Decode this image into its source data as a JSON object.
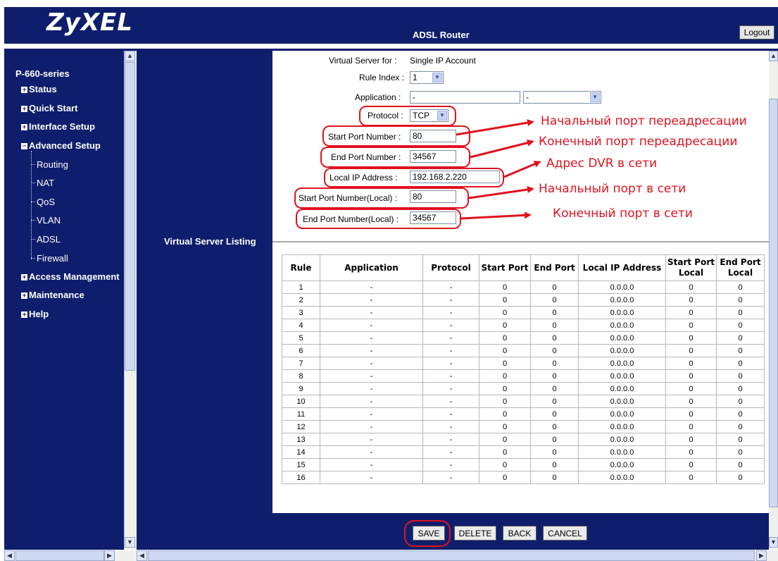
{
  "header": {
    "logo": "ZyXEL",
    "title": "ADSL Router",
    "logout_label": "Logout"
  },
  "sidebar": {
    "series": "P-660-series",
    "items": [
      {
        "label": "Status"
      },
      {
        "label": "Quick Start"
      },
      {
        "label": "Interface Setup"
      },
      {
        "label": "Advanced Setup"
      },
      {
        "label": "Access Management"
      },
      {
        "label": "Maintenance"
      },
      {
        "label": "Help"
      }
    ],
    "subitems": [
      "Routing",
      "NAT",
      "QoS",
      "VLAN",
      "ADSL",
      "Firewall"
    ]
  },
  "form": {
    "virtual_server_label": "Virtual Server for :",
    "virtual_server_value": "Single IP Account",
    "rule_index_label": "Rule Index :",
    "rule_index_value": "1",
    "application_label": "Application :",
    "application_value": "-",
    "application_select": "-",
    "protocol_label": "Protocol :",
    "protocol_value": "TCP",
    "start_port_label": "Start Port Number :",
    "start_port_value": "80",
    "end_port_label": "End Port Number :",
    "end_port_value": "34567",
    "local_ip_label": "Local IP Address :",
    "local_ip_value": "192.168.2.220",
    "start_port_local_label": "Start Port Number(Local) :",
    "start_port_local_value": "80",
    "end_port_local_label": "End Port Number(Local) :",
    "end_port_local_value": "34567"
  },
  "annotations": {
    "a1": "Начальный порт переадресации",
    "a2": "Конечный порт переадресации",
    "a3": "Адрес DVR в сети",
    "a4": "Начальный порт в сети",
    "a5": "Конечный порт в сети"
  },
  "listing": {
    "label": "Virtual Server Listing",
    "headers": [
      "Rule",
      "Application",
      "Protocol",
      "Start Port",
      "End Port",
      "Local IP Address",
      "Start Port Local",
      "End Port Local"
    ],
    "rows": [
      [
        "1",
        "-",
        "-",
        "0",
        "0",
        "0.0.0.0",
        "0",
        "0"
      ],
      [
        "2",
        "-",
        "-",
        "0",
        "0",
        "0.0.0.0",
        "0",
        "0"
      ],
      [
        "3",
        "-",
        "-",
        "0",
        "0",
        "0.0.0.0",
        "0",
        "0"
      ],
      [
        "4",
        "-",
        "-",
        "0",
        "0",
        "0.0.0.0",
        "0",
        "0"
      ],
      [
        "5",
        "-",
        "-",
        "0",
        "0",
        "0.0.0.0",
        "0",
        "0"
      ],
      [
        "6",
        "-",
        "-",
        "0",
        "0",
        "0.0.0.0",
        "0",
        "0"
      ],
      [
        "7",
        "-",
        "-",
        "0",
        "0",
        "0.0.0.0",
        "0",
        "0"
      ],
      [
        "8",
        "-",
        "-",
        "0",
        "0",
        "0.0.0.0",
        "0",
        "0"
      ],
      [
        "9",
        "-",
        "-",
        "0",
        "0",
        "0.0.0.0",
        "0",
        "0"
      ],
      [
        "10",
        "-",
        "-",
        "0",
        "0",
        "0.0.0.0",
        "0",
        "0"
      ],
      [
        "11",
        "-",
        "-",
        "0",
        "0",
        "0.0.0.0",
        "0",
        "0"
      ],
      [
        "12",
        "-",
        "-",
        "0",
        "0",
        "0.0.0.0",
        "0",
        "0"
      ],
      [
        "13",
        "-",
        "-",
        "0",
        "0",
        "0.0.0.0",
        "0",
        "0"
      ],
      [
        "14",
        "-",
        "-",
        "0",
        "0",
        "0.0.0.0",
        "0",
        "0"
      ],
      [
        "15",
        "-",
        "-",
        "0",
        "0",
        "0.0.0.0",
        "0",
        "0"
      ],
      [
        "16",
        "-",
        "-",
        "0",
        "0",
        "0.0.0.0",
        "0",
        "0"
      ]
    ]
  },
  "buttons": {
    "save": "SAVE",
    "delete": "DELETE",
    "back": "BACK",
    "cancel": "CANCEL"
  },
  "colors": {
    "frame_bg": "#0f1e6c",
    "annotation_red": "#e0131f"
  }
}
